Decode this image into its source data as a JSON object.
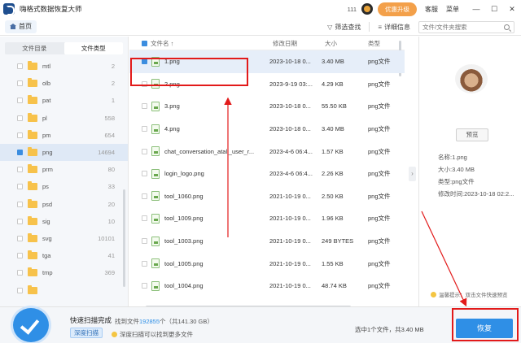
{
  "titlebar": {
    "app_title": "嗨格式数据恢复大师",
    "counter": "111",
    "upgrade_label": "优惠升级",
    "service_label": "客服",
    "menu_label": "菜单",
    "minimize": "—",
    "maximize": "☐",
    "close": "✕"
  },
  "toolbar": {
    "home_label": "首页",
    "filter_label": "筛选查找",
    "filter_icon": "▽",
    "detail_label": "详细信息",
    "detail_icon": "≡",
    "search_placeholder": "文件/文件夹搜索"
  },
  "sidebar": {
    "tabs": [
      "文件目录",
      "文件类型"
    ],
    "active_tab": "文件类型",
    "items": [
      {
        "name": "mtl",
        "count": "2"
      },
      {
        "name": "olb",
        "count": "2"
      },
      {
        "name": "pat",
        "count": "1"
      },
      {
        "name": "pl",
        "count": "558"
      },
      {
        "name": "pm",
        "count": "654"
      },
      {
        "name": "png",
        "count": "14694"
      },
      {
        "name": "prm",
        "count": "80"
      },
      {
        "name": "ps",
        "count": "33"
      },
      {
        "name": "psd",
        "count": "20"
      },
      {
        "name": "sig",
        "count": "10"
      },
      {
        "name": "svg",
        "count": "10101"
      },
      {
        "name": "tga",
        "count": "41"
      },
      {
        "name": "tmp",
        "count": "369"
      },
      {
        "name": "",
        "count": ""
      }
    ]
  },
  "file_list": {
    "headers": {
      "name": "文件名",
      "sort_icon": "↑",
      "date": "修改日期",
      "size": "大小",
      "type": "类型"
    },
    "rows": [
      {
        "name": "1.png",
        "date": "2023-10-18 0...",
        "size": "3.40 MB",
        "type": "png文件",
        "selected": true
      },
      {
        "name": "2.png",
        "date": "2023-9-19 03:...",
        "size": "4.29 KB",
        "type": "png文件"
      },
      {
        "name": "3.png",
        "date": "2023-10-18 0...",
        "size": "55.50 KB",
        "type": "png文件"
      },
      {
        "name": "4.png",
        "date": "2023-10-18 0...",
        "size": "3.40 MB",
        "type": "png文件"
      },
      {
        "name": "chat_conversation_atall_user_r...",
        "date": "2023-4-6 06:4...",
        "size": "1.57 KB",
        "type": "png文件"
      },
      {
        "name": "login_logo.png",
        "date": "2023-4-6 06:4...",
        "size": "2.26 KB",
        "type": "png文件"
      },
      {
        "name": "tool_1060.png",
        "date": "2021-10-19 0...",
        "size": "2.50 KB",
        "type": "png文件"
      },
      {
        "name": "tool_1009.png",
        "date": "2021-10-19 0...",
        "size": "1.96 KB",
        "type": "png文件"
      },
      {
        "name": "tool_1003.png",
        "date": "2021-10-19 0...",
        "size": "249 BYTES",
        "type": "png文件"
      },
      {
        "name": "tool_1005.png",
        "date": "2021-10-19 0...",
        "size": "1.55 KB",
        "type": "png文件"
      },
      {
        "name": "tool_1004.png",
        "date": "2021-10-19 0...",
        "size": "48.74 KB",
        "type": "png文件"
      }
    ]
  },
  "preview": {
    "preview_button": "预览",
    "meta": [
      "名称:1.png",
      "大小:3.40 MB",
      "类型:png文件",
      "修改时间:2023-10-18 02:2..."
    ],
    "tip": "温馨提示：双击文件快速预览",
    "collapse_icon": "›"
  },
  "bottombar": {
    "scan_title": "快速扫描完成",
    "found_prefix": "找到文件",
    "found_count": "192855",
    "found_suffix": "个（共141.30 GB）",
    "deep_scan_label": "深度扫描",
    "deep_tip": "深度扫描可以找到更多文件",
    "selection_info": "选中1个文件，共3.40 MB",
    "recover_label": "恢复"
  },
  "colors": {
    "accent": "#2f8fe6",
    "annotation": "#e21a1a",
    "upgrade": "#f3a04a"
  }
}
